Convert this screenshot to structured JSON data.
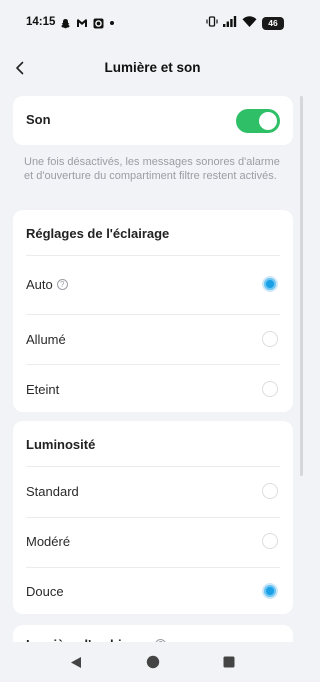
{
  "status_bar": {
    "time": "14:15",
    "battery": "46",
    "icons_left": [
      "snapchat-icon",
      "gmail-icon",
      "app-icon",
      "dot-icon"
    ],
    "icons_right": [
      "vibrate-icon",
      "signal-icon",
      "wifi-icon",
      "battery-icon"
    ]
  },
  "header": {
    "title": "Lumière et son",
    "back_icon": "chevron-left-icon"
  },
  "sound": {
    "label": "Son",
    "enabled": true,
    "note": "Une fois désactivés, les messages sonores d'alarme et d'ouverture du compartiment filtre restent activés."
  },
  "lighting": {
    "title": "Réglages de l'éclairage",
    "options": [
      {
        "label": "Auto",
        "selected": true,
        "info": true
      },
      {
        "label": "Allumé",
        "selected": false,
        "info": false
      },
      {
        "label": "Eteint",
        "selected": false,
        "info": false
      }
    ]
  },
  "brightness": {
    "title": "Luminosité",
    "options": [
      {
        "label": "Standard",
        "selected": false
      },
      {
        "label": "Modéré",
        "selected": false
      },
      {
        "label": "Douce",
        "selected": true
      }
    ]
  },
  "ambient": {
    "title": "Lumière d'ambiance"
  },
  "colors": {
    "accent_blue": "#1aa0e6",
    "toggle_green": "#2fbf67",
    "background": "#f2f3f6"
  },
  "nav": {
    "back_icon": "triangle-back-icon",
    "home_icon": "circle-home-icon",
    "recents_icon": "square-recents-icon"
  }
}
